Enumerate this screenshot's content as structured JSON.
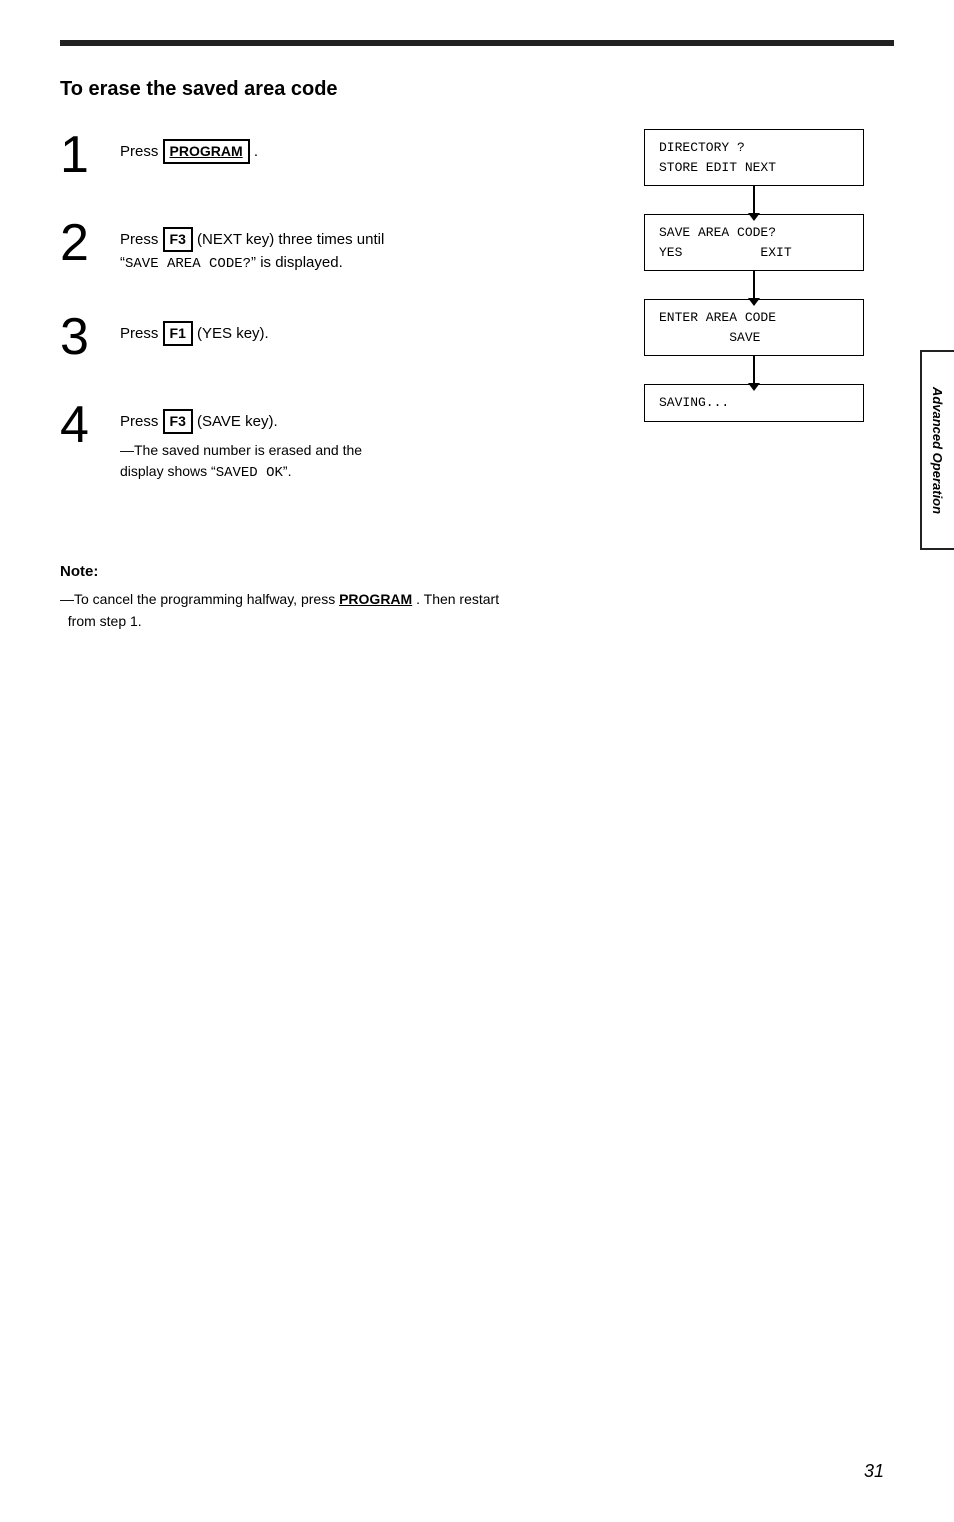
{
  "page": {
    "number": "31",
    "side_label": "Advanced Operation",
    "top_border": true
  },
  "section": {
    "title": "To erase the saved area code"
  },
  "steps": [
    {
      "number": "1",
      "text_before": "Press ",
      "key": "PROGRAM",
      "text_after": "."
    },
    {
      "number": "2",
      "text_before": "Press ",
      "key": "F3",
      "text_middle": " (NEXT key) three times until “",
      "code": "SAVE  AREA  CODE?",
      "text_after": "” is displayed."
    },
    {
      "number": "3",
      "text_before": "Press ",
      "key": "F1",
      "text_after": " (YES key)."
    },
    {
      "number": "4",
      "text_before": "Press ",
      "key": "F3",
      "text_after": " (SAVE key).",
      "sub_lines": [
        "—The saved number is erased and the",
        "display shows “SAVED  OK”."
      ]
    }
  ],
  "flowchart": {
    "boxes": [
      {
        "lines": [
          "DIRECTORY  ?",
          "STORE  EDIT  NEXT"
        ]
      },
      {
        "lines": [
          "SAVE  AREA  CODE?",
          "YES          EXIT"
        ]
      },
      {
        "lines": [
          "ENTER  AREA  CODE",
          "          SAVE"
        ]
      },
      {
        "lines": [
          "SAVING..."
        ]
      }
    ]
  },
  "note": {
    "title": "Note:",
    "lines": [
      "—To cancel the programming halfway, press ",
      "PROGRAM",
      ". Then restart from step 1."
    ]
  }
}
